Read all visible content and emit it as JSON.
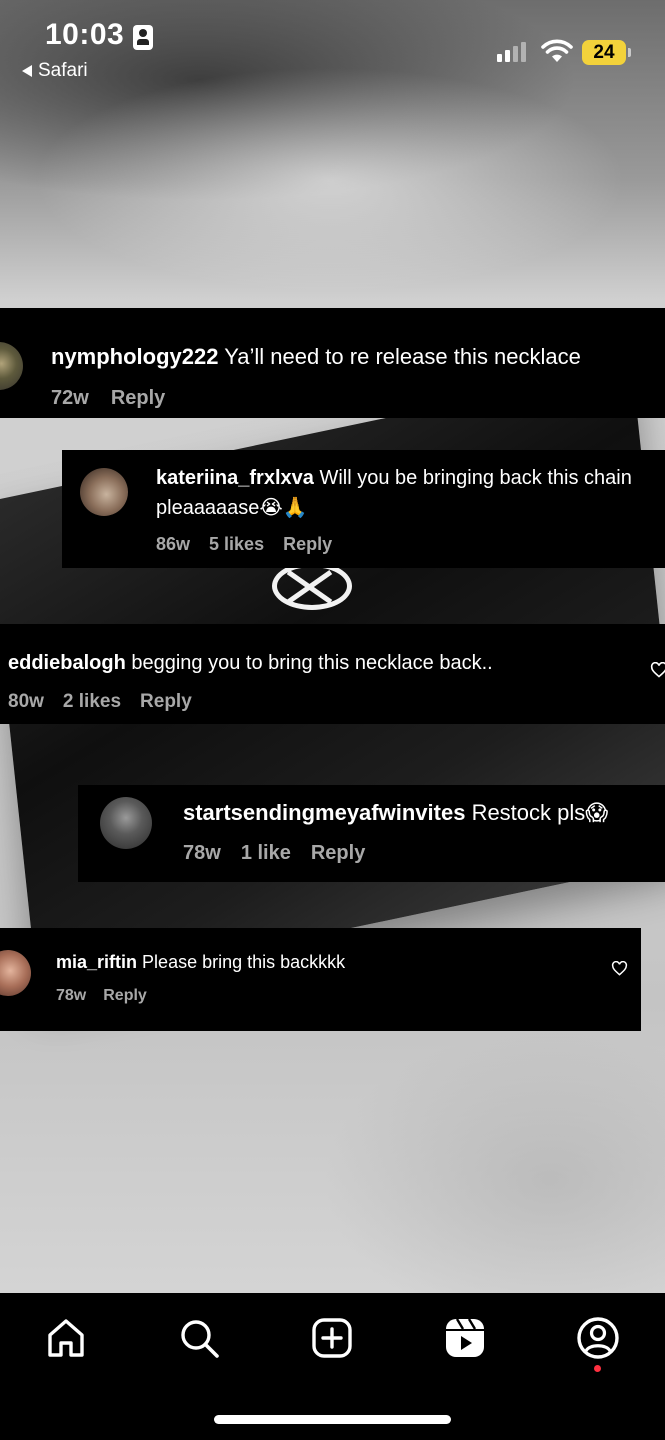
{
  "status_bar": {
    "time": "10:03",
    "back_app": "Safari",
    "battery": "24",
    "battery_color": "#f3d23b"
  },
  "comments": [
    {
      "username": "nymphology222",
      "text": "Ya’ll need to re release this necklace",
      "age": "72w",
      "likes": "",
      "reply": "Reply"
    },
    {
      "username": "kateriina_frxlxva",
      "text": "Will you be bringing back this chain",
      "text_line2": "pleaaaaase😭🙏",
      "age": "86w",
      "likes": "5 likes",
      "reply": "Reply"
    },
    {
      "username": "eddiebalogh",
      "text": "begging you to bring this necklace back..",
      "age": "80w",
      "likes": "2 likes",
      "reply": "Reply"
    },
    {
      "username": "startsendingmeyafwinvites",
      "text": "Restock pls😱",
      "age": "78w",
      "likes": "1 like",
      "reply": "Reply"
    },
    {
      "username": "mia_riftin",
      "text": "Please bring this backkkk",
      "age": "78w",
      "likes": "",
      "reply": "Reply"
    }
  ],
  "tab_bar": {
    "items": [
      "home-icon",
      "search-icon",
      "create-post-icon",
      "reels-icon",
      "profile-icon"
    ],
    "notification_color": "#ff3040"
  }
}
